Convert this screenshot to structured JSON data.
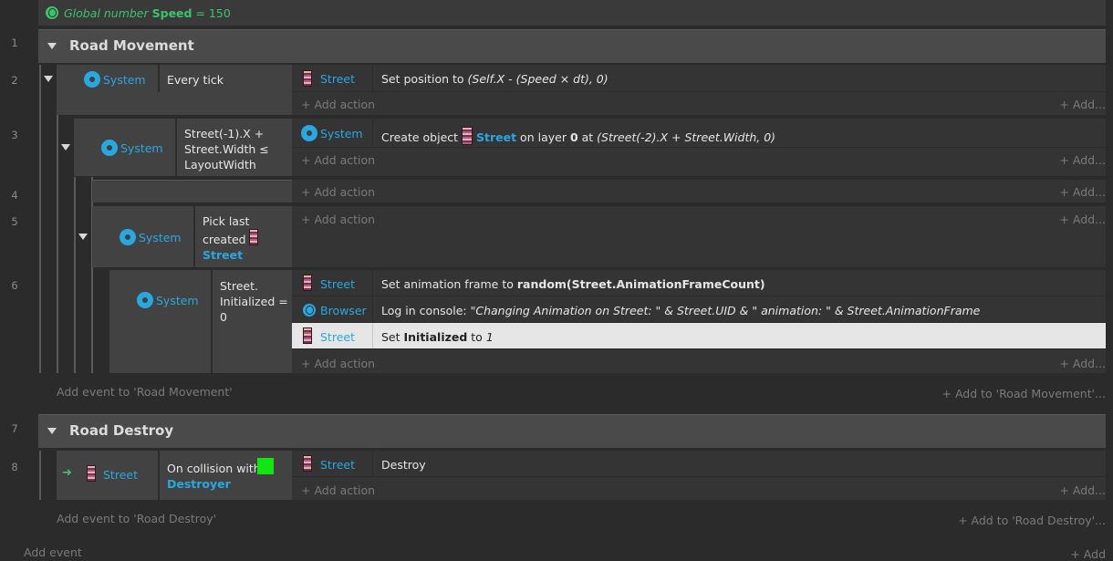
{
  "global_var": {
    "prefix": "Global number",
    "name": "Speed",
    "suffix": "= 150"
  },
  "line_numbers": [
    "1",
    "2",
    "3",
    "4",
    "5",
    "6",
    "7",
    "8"
  ],
  "groups": [
    {
      "title": "Road Movement",
      "add_event": "Add event to 'Road Movement'",
      "add_to": "Add to 'Road Movement'..."
    },
    {
      "title": "Road Destroy",
      "add_event": "Add event to 'Road Destroy'",
      "add_to": "Add to 'Road Destroy'..."
    }
  ],
  "common": {
    "add_action": "Add action",
    "add": "Add...",
    "system": "System",
    "street": "Street",
    "browser": "Browser"
  },
  "events": {
    "e2": {
      "cond": "Every tick",
      "act1_pre": "Set position to ",
      "act1_expr": "(Self.X - (Speed × dt), 0)"
    },
    "e3": {
      "cond": "Street(-1).X + Street.Width ≤ LayoutWidth",
      "act_pre": "Create object ",
      "act_obj": "Street",
      "act_mid1": " on layer ",
      "act_layer": "0",
      "act_mid2": " at ",
      "act_expr": "(Street(-2).X + Street.Width, 0)"
    },
    "e5": {
      "cond_l1": "Pick last",
      "cond_l2": "created",
      "cond_obj": "Street"
    },
    "e6": {
      "cond": "Street. Initialized = 0",
      "a1_pre": "Set animation frame to ",
      "a1_expr": "random(Street.AnimationFrameCount)",
      "a2_pre": "Log in console: ",
      "a2_expr": "\"Changing Animation on Street: \" & Street.UID & \" animation: \" & Street.AnimationFrame",
      "a3_pre": "Set ",
      "a3_bold": "Initialized",
      "a3_mid": " to ",
      "a3_val": "1"
    },
    "e8": {
      "cond_pre": "On collision with",
      "cond_obj": "Destroyer",
      "act": "Destroy"
    }
  },
  "footer": {
    "add_event": "Add event",
    "add": "Add"
  },
  "colors": {
    "accent": "#29a8e0",
    "global_green": "#3cc46a",
    "destroyer_green": "#11e611"
  }
}
